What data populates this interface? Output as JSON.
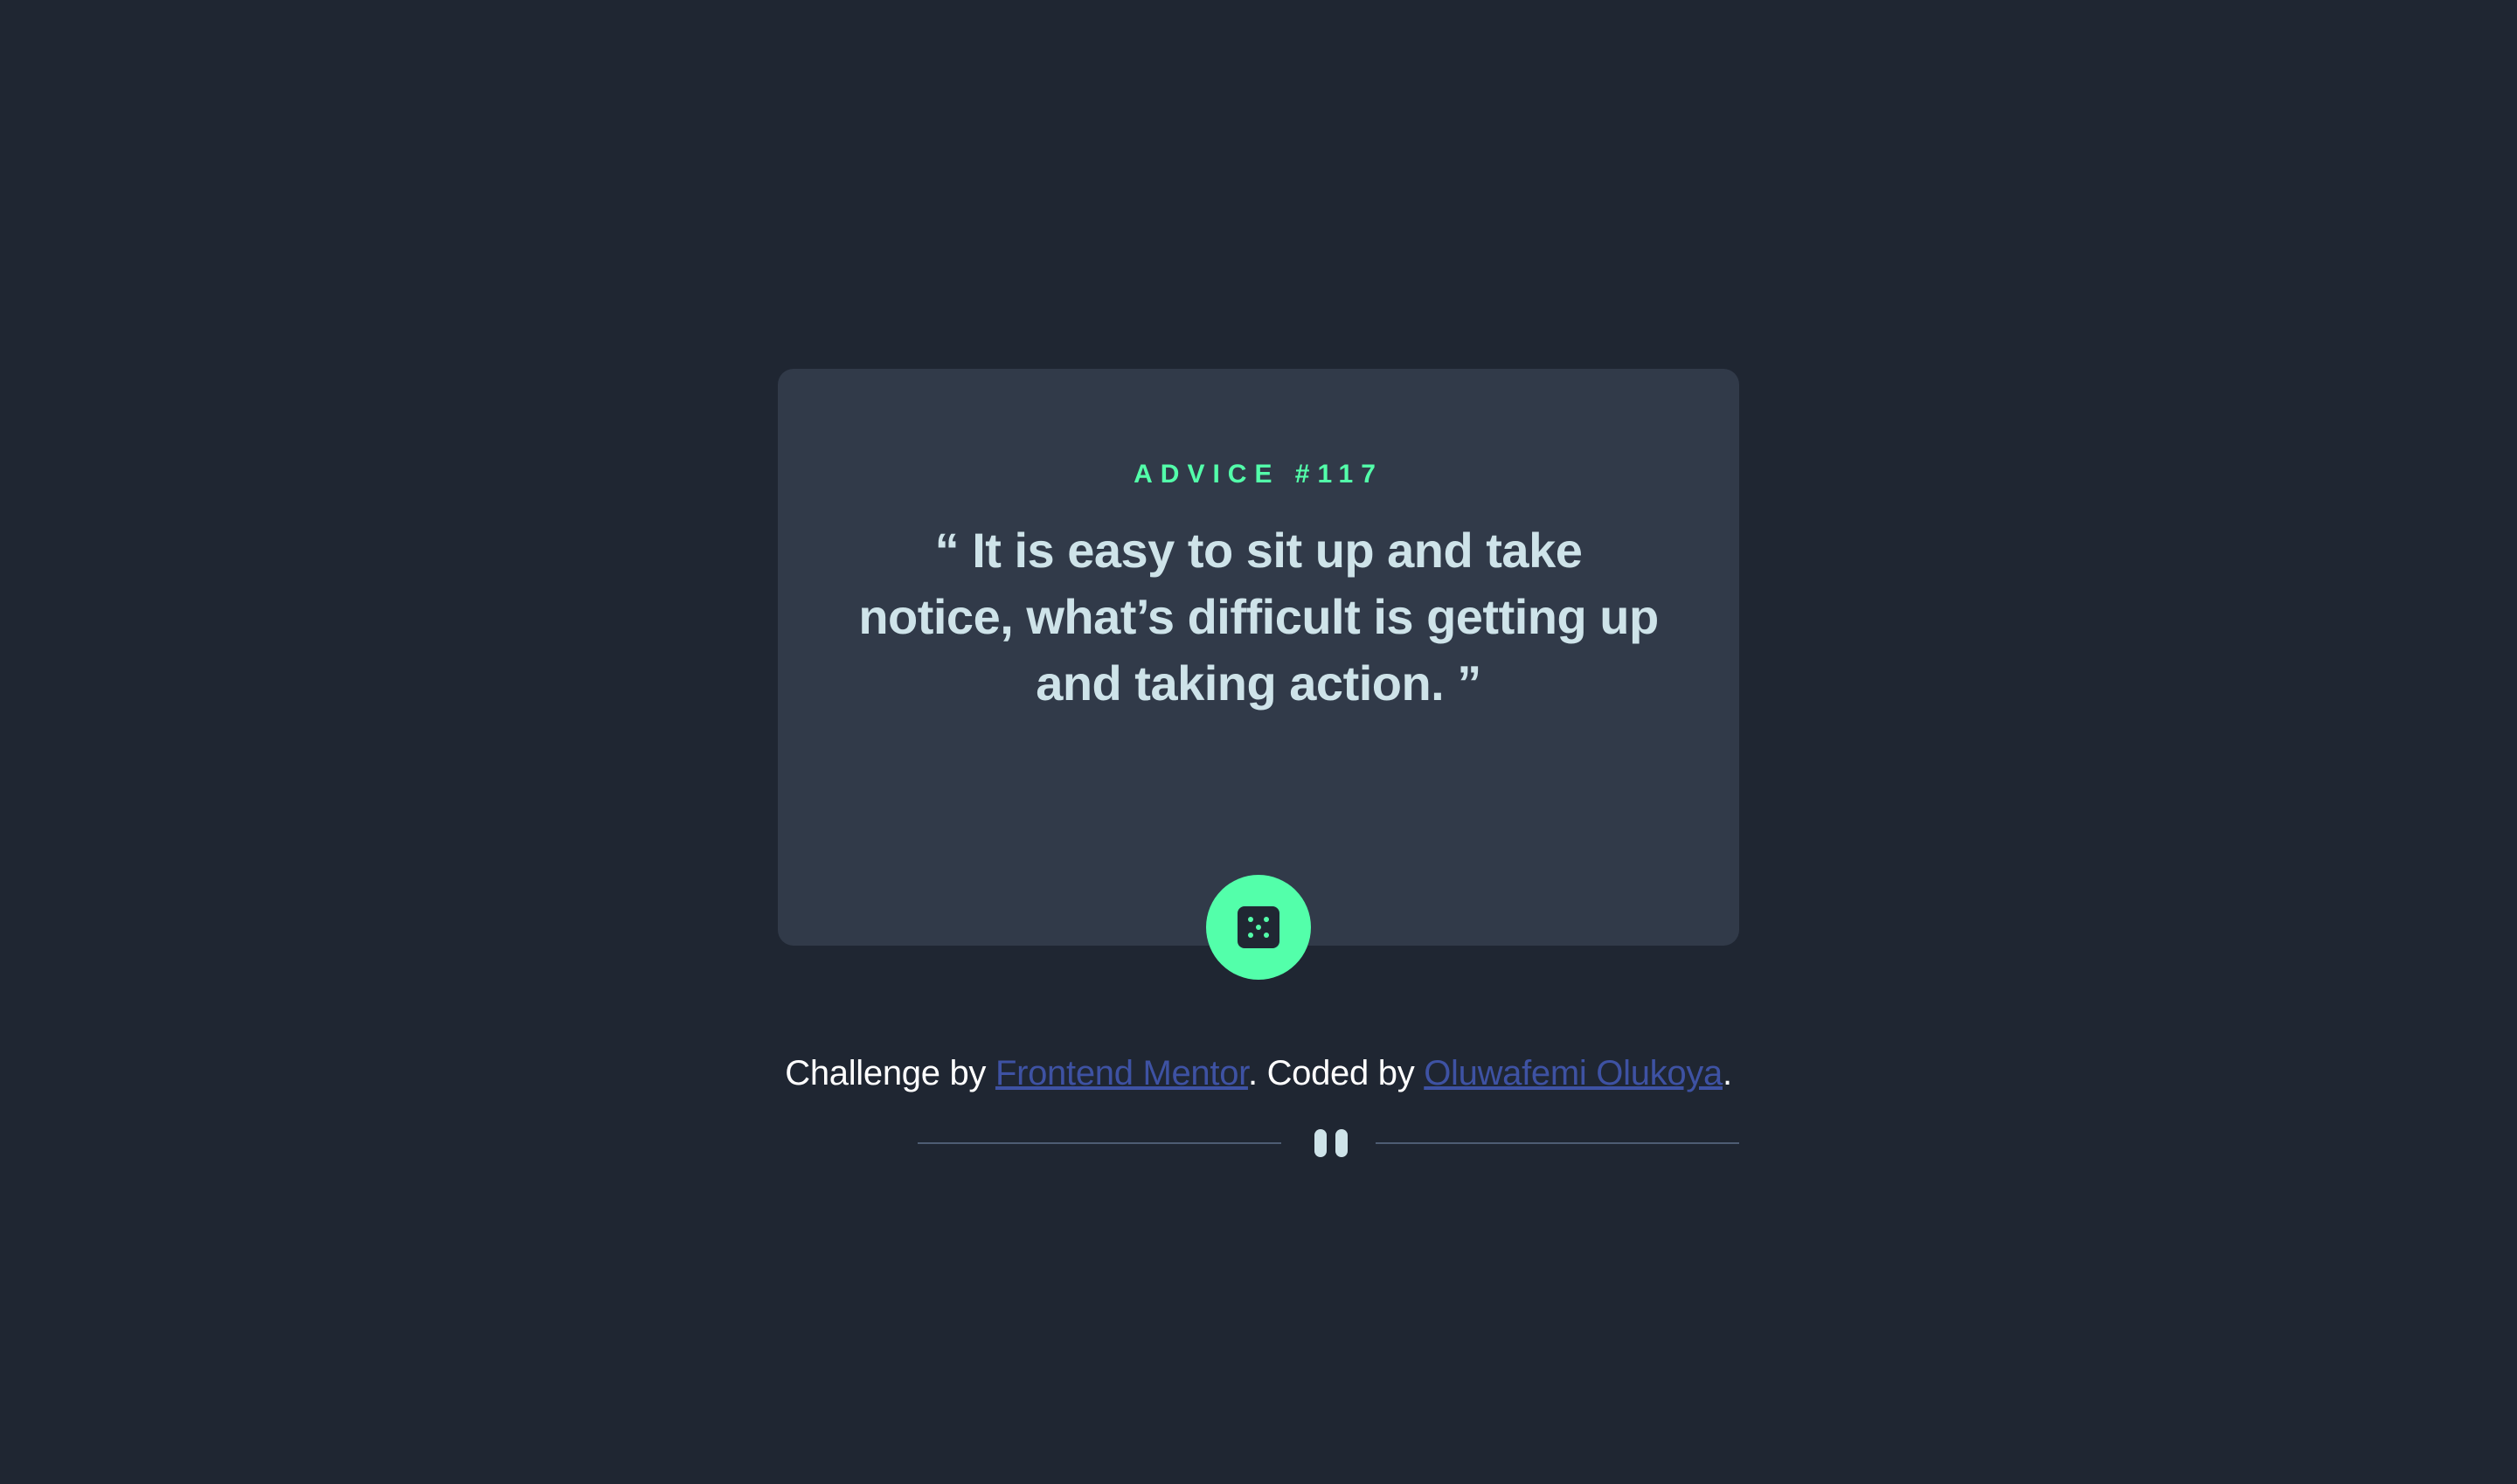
{
  "card": {
    "advice_id": "ADVICE #117",
    "quote": "“ It is easy to sit up and take notice, what’s difficult is getting up and taking action. ”"
  },
  "icons": {
    "divider": "pause-icon",
    "button": "dice-icon"
  },
  "footer": {
    "prefix": "Challenge by ",
    "link1": "Frontend Mentor",
    "middle": ". Coded by ",
    "link2": "Oluwafemi Olukoya",
    "suffix": "."
  },
  "colors": {
    "background": "#1f2632",
    "card": "#313a49",
    "accent": "#53ffaa",
    "text": "#cee3e9",
    "link": "#3e52a3"
  }
}
